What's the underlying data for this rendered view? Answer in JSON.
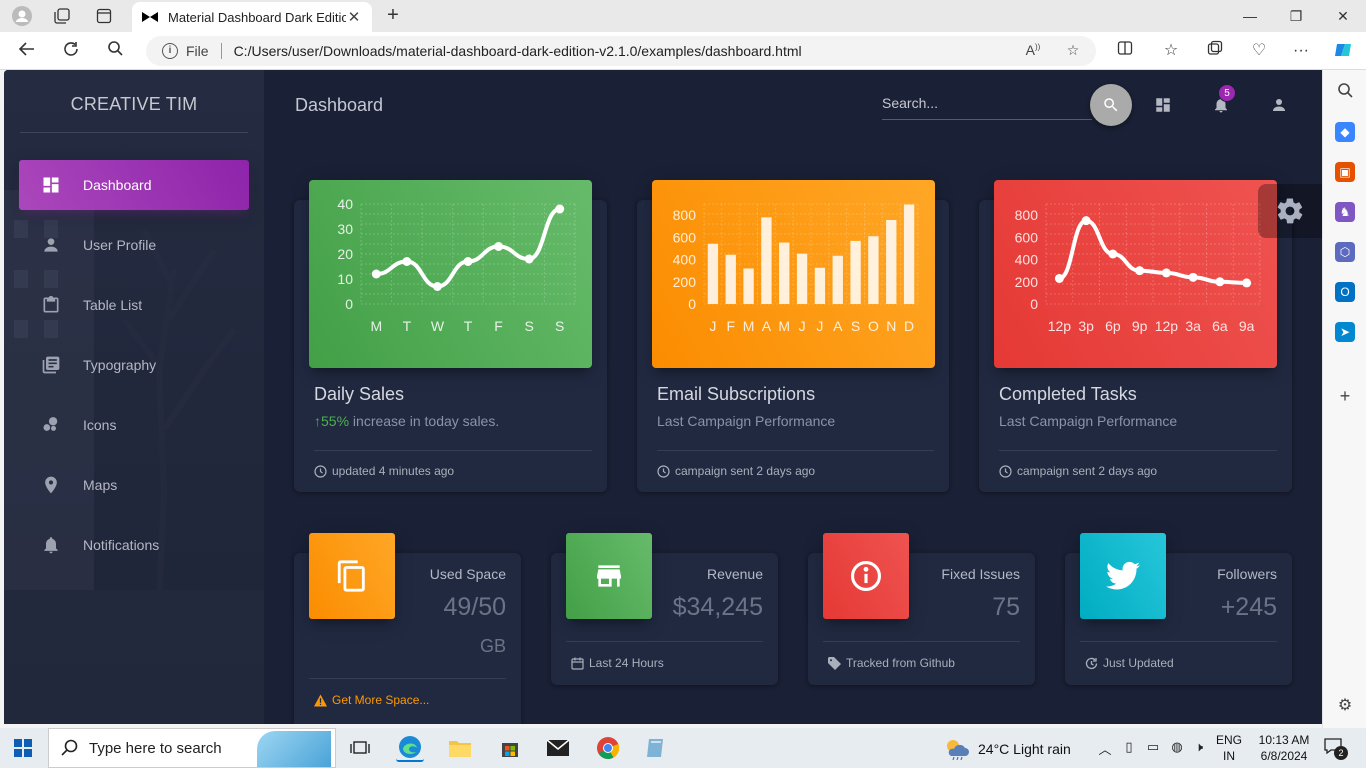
{
  "browser": {
    "tab_title": "Material Dashboard Dark Edition",
    "address_file_label": "File",
    "url": "C:/Users/user/Downloads/material-dashboard-dark-edition-v2.1.0/examples/dashboard.html"
  },
  "sidebar": {
    "brand": "CREATIVE TIM",
    "items": [
      {
        "label": "Dashboard",
        "icon": "dashboard-icon",
        "active": true
      },
      {
        "label": "User Profile",
        "icon": "person-icon"
      },
      {
        "label": "Table List",
        "icon": "clipboard-icon"
      },
      {
        "label": "Typography",
        "icon": "library-books-icon"
      },
      {
        "label": "Icons",
        "icon": "bubble-chart-icon"
      },
      {
        "label": "Maps",
        "icon": "location-icon"
      },
      {
        "label": "Notifications",
        "icon": "bell-icon"
      }
    ]
  },
  "navbar": {
    "title": "Dashboard",
    "search_placeholder": "Search...",
    "notification_count": "5"
  },
  "charts": {
    "daily_sales": {
      "title": "Daily Sales",
      "pct": "55%",
      "category_rest": " increase in today sales.",
      "footer": "updated 4 minutes ago",
      "color": "#43a047"
    },
    "email_subscriptions": {
      "title": "Email Subscriptions",
      "category": "Last Campaign Performance",
      "footer": "campaign sent 2 days ago",
      "color": "#fb8c00"
    },
    "completed_tasks": {
      "title": "Completed Tasks",
      "category": "Last Campaign Performance",
      "footer": "campaign sent 2 days ago",
      "color": "#e53935"
    }
  },
  "chart_data": [
    {
      "type": "line",
      "title": "Daily Sales",
      "categories": [
        "M",
        "T",
        "W",
        "T",
        "F",
        "S",
        "S"
      ],
      "values": [
        12,
        17,
        7,
        17,
        23,
        18,
        38
      ],
      "ylim": [
        0,
        40
      ],
      "yticks": [
        "0",
        "10",
        "20",
        "30",
        "40"
      ],
      "grid": true
    },
    {
      "type": "bar",
      "title": "Email Subscriptions",
      "categories": [
        "J",
        "F",
        "M",
        "A",
        "M",
        "J",
        "J",
        "A",
        "S",
        "O",
        "N",
        "D"
      ],
      "values": [
        542,
        443,
        320,
        780,
        553,
        453,
        326,
        434,
        568,
        610,
        756,
        895
      ],
      "ylim": [
        0,
        900
      ],
      "yticks": [
        "0",
        "200",
        "400",
        "600",
        "800"
      ],
      "grid": true
    },
    {
      "type": "line",
      "title": "Completed Tasks",
      "categories": [
        "12p",
        "3p",
        "6p",
        "9p",
        "12p",
        "3a",
        "6a",
        "9a"
      ],
      "values": [
        230,
        750,
        450,
        300,
        280,
        240,
        200,
        190
      ],
      "ylim": [
        0,
        900
      ],
      "yticks": [
        "0",
        "200",
        "400",
        "600",
        "800"
      ],
      "grid": true
    }
  ],
  "stats": [
    {
      "category": "Used Space",
      "value": "49/50",
      "unit": "GB",
      "footer": "Get More Space...",
      "icon": "content-copy-icon",
      "color": "#fb8c00"
    },
    {
      "category": "Revenue",
      "value": "$34,245",
      "footer": "Last 24 Hours",
      "icon": "store-icon",
      "color": "#43a047"
    },
    {
      "category": "Fixed Issues",
      "value": "75",
      "footer": "Tracked from Github",
      "icon": "info-outline-icon",
      "color": "#e53935"
    },
    {
      "category": "Followers",
      "value": "+245",
      "footer": "Just Updated",
      "icon": "twitter-icon",
      "color": "#00acc1"
    }
  ],
  "taskbar": {
    "search_placeholder": "Type here to search",
    "weather": "24°C  Light rain",
    "lang_top": "ENG",
    "lang_bottom": "IN",
    "time": "10:13 AM",
    "date": "6/8/2024",
    "notif_count": "2"
  }
}
